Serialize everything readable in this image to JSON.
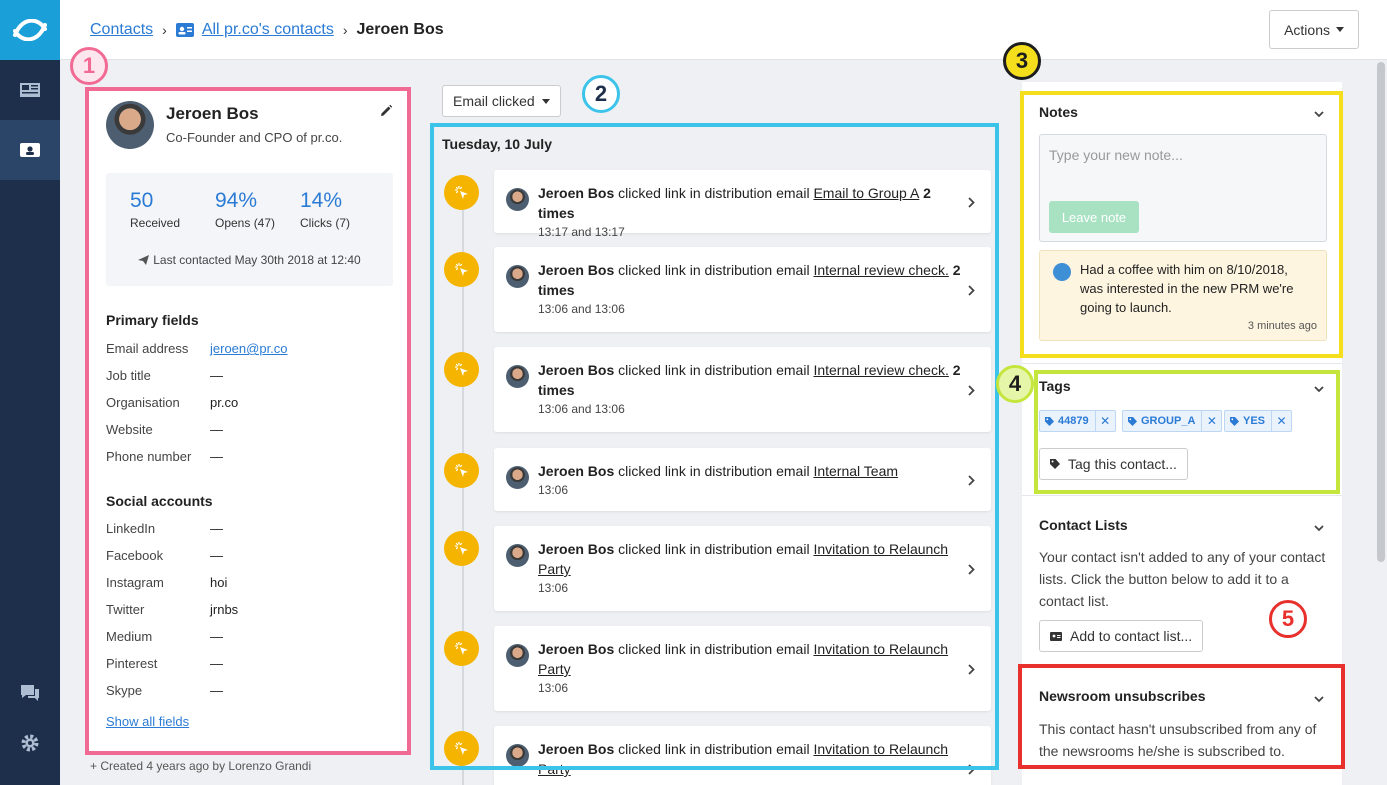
{
  "nav": {
    "items": [
      {
        "icon": "newsroom-icon"
      },
      {
        "icon": "contacts-card-icon"
      }
    ],
    "bottom": [
      {
        "icon": "chat-icon"
      },
      {
        "icon": "gear-icon"
      }
    ]
  },
  "header": {
    "breadcrumb": [
      "Contacts",
      "All pr.co's contacts",
      "Jeroen Bos"
    ],
    "actions_label": "Actions"
  },
  "profile": {
    "name": "Jeroen Bos",
    "title": "Co-Founder and CPO of pr.co.",
    "stats": [
      {
        "value": "50",
        "label": "Received"
      },
      {
        "value": "94%",
        "label": "Opens (47)"
      },
      {
        "value": "14%",
        "label": "Clicks (7)"
      }
    ],
    "last_contacted": "Last contacted May 30th 2018 at 12:40",
    "primary_heading": "Primary fields",
    "primary_fields": [
      {
        "key": "Email address",
        "value": "jeroen@pr.co"
      },
      {
        "key": "Job title",
        "value": "—"
      },
      {
        "key": "Organisation",
        "value": "pr.co"
      },
      {
        "key": "Website",
        "value": "—"
      },
      {
        "key": "Phone number",
        "value": "—"
      }
    ],
    "social_heading": "Social accounts",
    "social_fields": [
      {
        "key": "LinkedIn",
        "value": "—"
      },
      {
        "key": "Facebook",
        "value": "—"
      },
      {
        "key": "Instagram",
        "value": "hoi"
      },
      {
        "key": "Twitter",
        "value": "jrnbs"
      },
      {
        "key": "Medium",
        "value": "—"
      },
      {
        "key": "Pinterest",
        "value": "—"
      },
      {
        "key": "Skype",
        "value": "—"
      }
    ],
    "show_all": "Show all fields",
    "created": "+ Created 4 years ago by Lorenzo Grandi"
  },
  "timeline": {
    "filter_label": "Email clicked",
    "date": "Tuesday, 10 July",
    "events": [
      {
        "actor": "Jeroen Bos",
        "action": " clicked link in distribution email ",
        "email": "Email to Group A",
        "count": " 2 times",
        "time": "13:17 and 13:17"
      },
      {
        "actor": "Jeroen Bos",
        "action": " clicked link in distribution email ",
        "email": "Internal review check.",
        "count": " 2 times",
        "time": "13:06 and 13:06"
      },
      {
        "actor": "Jeroen Bos",
        "action": " clicked link in distribution email ",
        "email": "Internal review check.",
        "count": " 2 times",
        "time": "13:06 and 13:06"
      },
      {
        "actor": "Jeroen Bos",
        "action": " clicked link in distribution email ",
        "email": "Internal Team",
        "count": "",
        "time": "13:06"
      },
      {
        "actor": "Jeroen Bos",
        "action": " clicked link in distribution email ",
        "email": "Invitation to Relaunch Party",
        "count": "",
        "time": "13:06"
      },
      {
        "actor": "Jeroen Bos",
        "action": " clicked link in distribution email ",
        "email": "Invitation to Relaunch Party",
        "count": "",
        "time": "13:06"
      },
      {
        "actor": "Jeroen Bos",
        "action": " clicked link in distribution email ",
        "email": "Invitation to Relaunch Party",
        "count": "",
        "time": ""
      }
    ]
  },
  "notes": {
    "title": "Notes",
    "placeholder": "Type your new note...",
    "leave_label": "Leave note",
    "note_text": "Had a coffee with him on 8/10/2018, was interested in the new PRM we're going to launch.",
    "note_time": "3 minutes ago"
  },
  "tags": {
    "title": "Tags",
    "items": [
      "44879",
      "GROUP_A",
      "YES"
    ],
    "add_label": "Tag this contact..."
  },
  "contact_lists": {
    "title": "Contact Lists",
    "body": "Your contact isn't added to any of your contact lists. Click the button below to add it to a contact list.",
    "add_label": "Add to contact list..."
  },
  "newsroom": {
    "title": "Newsroom unsubscribes",
    "body": "This contact hasn't unsubscribed from any of the newsrooms he/she is subscribed to."
  },
  "annotations": {
    "labels": [
      "1",
      "2",
      "3",
      "4",
      "5"
    ],
    "colors": {
      "1": "#f06a94",
      "2": "#3cc3ea",
      "3": "#f5de1c",
      "4": "#c4e63c",
      "5": "#e8302c"
    }
  }
}
